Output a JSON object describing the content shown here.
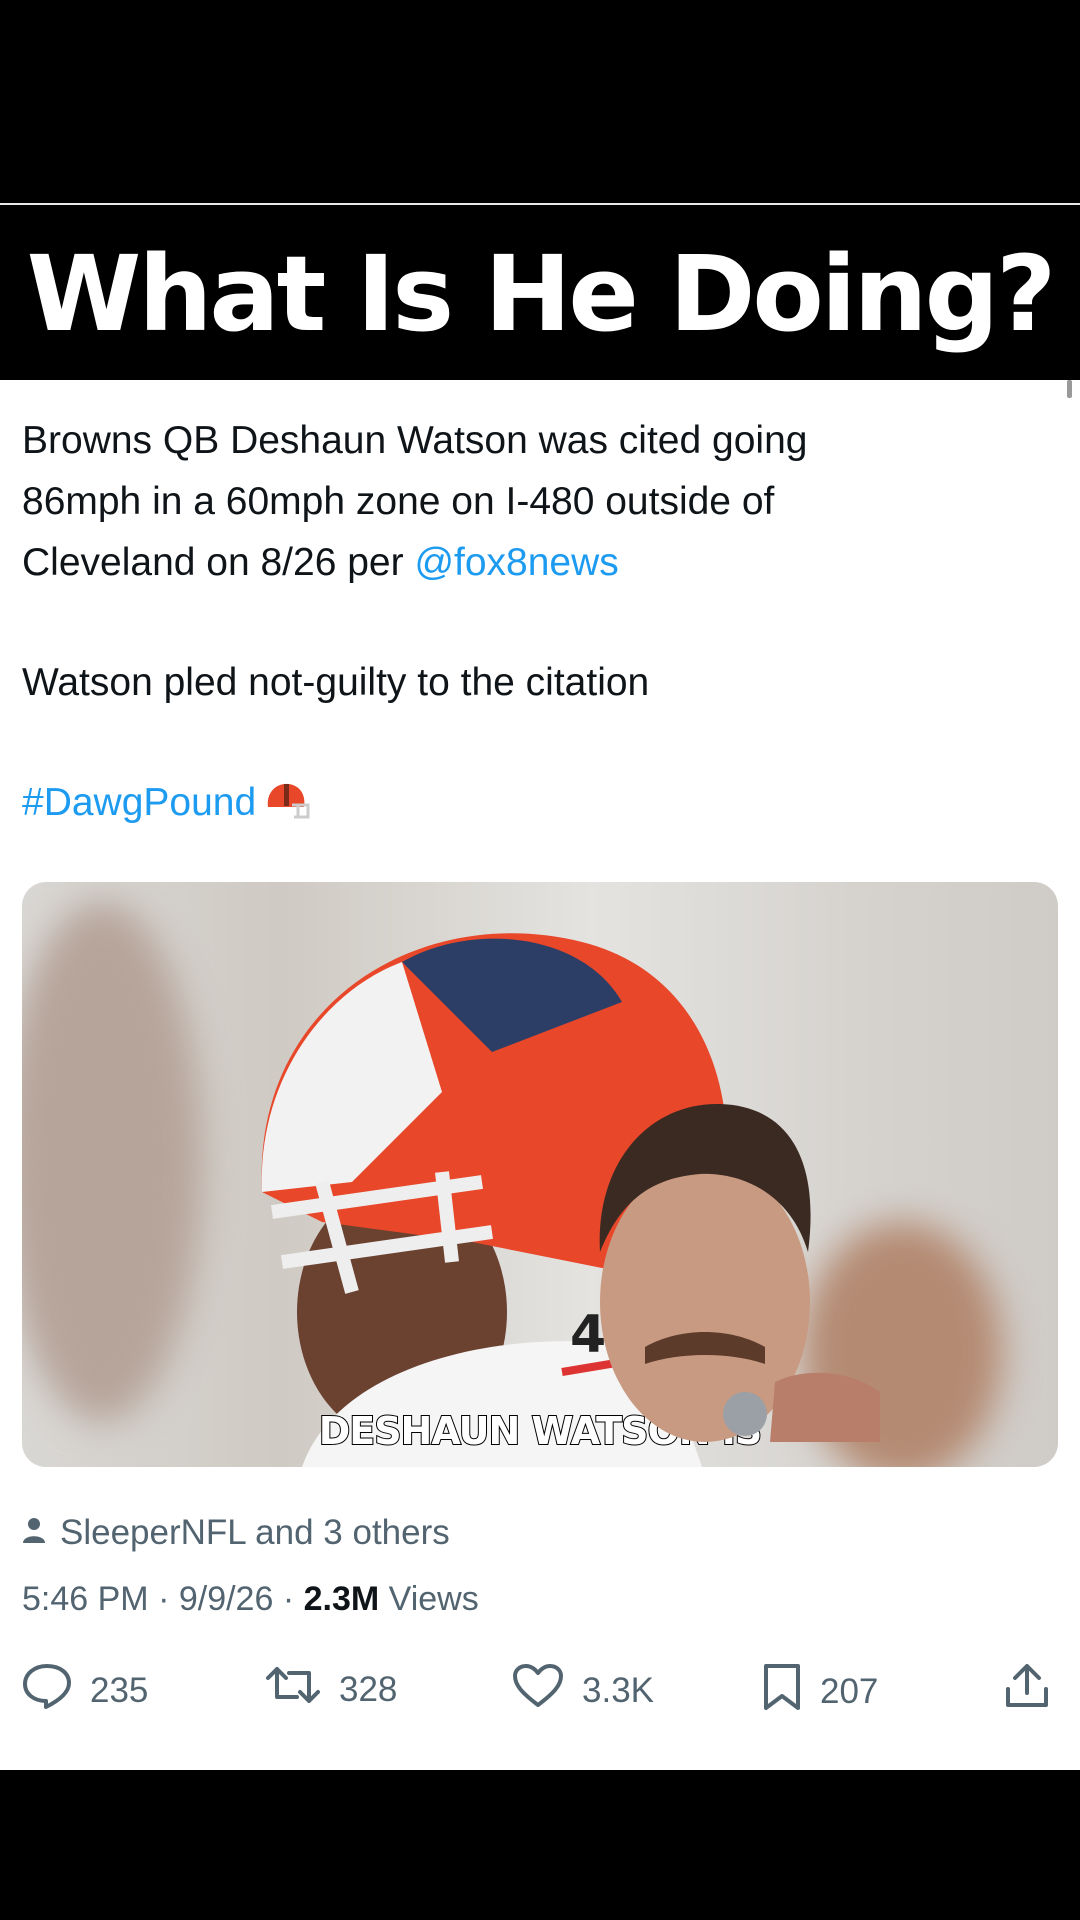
{
  "title": "What Is He Doing?",
  "tweet": {
    "lines": [
      "Browns QB Deshaun Watson was cited going",
      "86mph in a 60mph zone on I-480 outside of",
      "Cleveland on 8/26 per "
    ],
    "mention": "@fox8news",
    "paragraph2": "Watson pled not-guilty to the citation",
    "hashtag": "#DawgPound",
    "emoji_icon": "football-helmet-icon",
    "media_caption": "DESHAUN WATSON IS",
    "media_jersey_number": "4",
    "liked_by": "SleeperNFL and 3 others",
    "time": "5:46 PM",
    "date": "9/9/26",
    "views_count": "2.3M",
    "views_label": "Views",
    "replies": "235",
    "reposts": "328",
    "likes": "3.3K",
    "bookmarks": "207"
  },
  "colors": {
    "link": "#1d9bf0",
    "text": "#0f1419",
    "secondary": "#536471",
    "helmet_orange": "#e8472a"
  }
}
